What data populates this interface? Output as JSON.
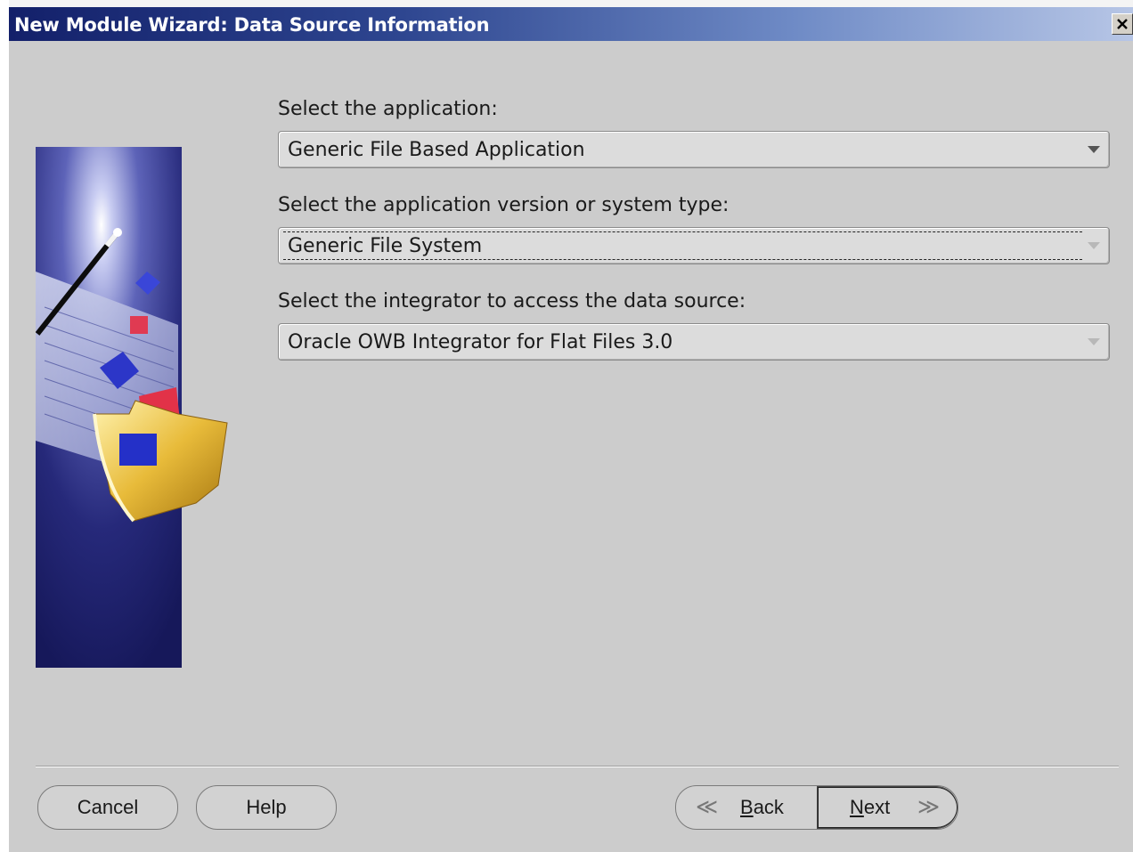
{
  "window": {
    "title": "New Module Wizard: Data Source Information",
    "close_symbol": "✕"
  },
  "form": {
    "application": {
      "label": "Select the application:",
      "value": "Generic File Based Application"
    },
    "version": {
      "label": "Select the application version or system type:",
      "value": "Generic File System"
    },
    "integrator": {
      "label": "Select the integrator to access the data source:",
      "value": "Oracle OWB Integrator for Flat Files 3.0"
    }
  },
  "buttons": {
    "cancel": "Cancel",
    "help": "Help",
    "back_prefix": "",
    "back_mnemonic": "B",
    "back_rest": "ack",
    "next_mnemonic": "N",
    "next_rest": "ext"
  },
  "icons": {
    "wizard_illustration": "magic-wand-folder-illustration",
    "close": "close-icon",
    "back": "chevron-left-icon",
    "next": "chevron-right-icon"
  }
}
